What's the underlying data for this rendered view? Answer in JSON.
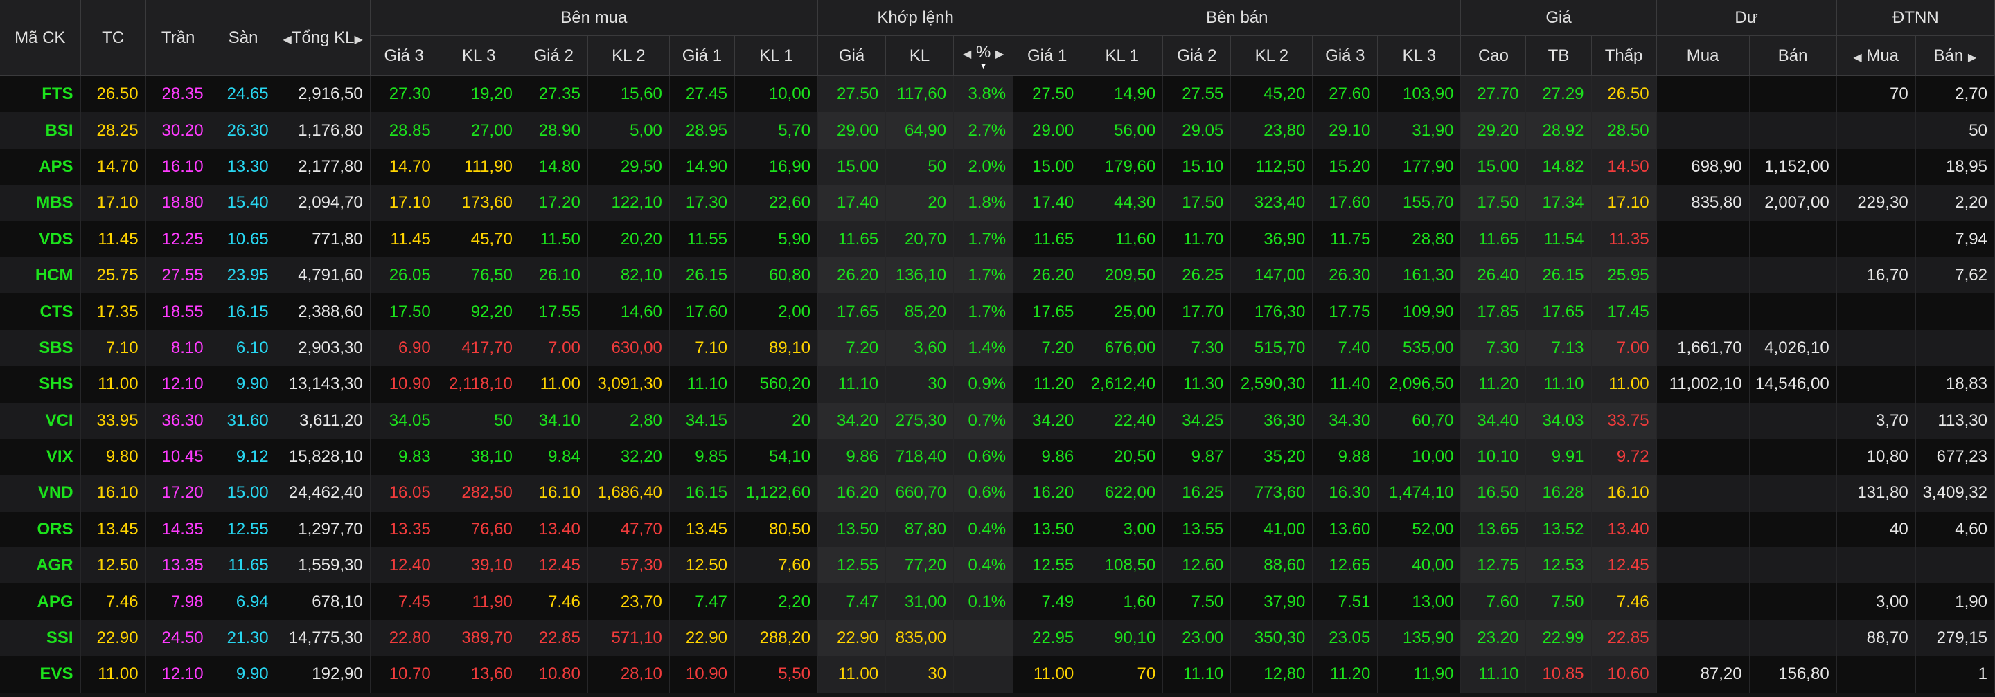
{
  "header": {
    "symbol": "Mã CK",
    "ref": "TC",
    "ceil": "Trần",
    "floor": "Sàn",
    "total_vol": "Tổng KL",
    "buy_side": "Bên mua",
    "matched": "Khớp lệnh",
    "sell_side": "Bên bán",
    "price": "Giá",
    "remain": "Dư",
    "foreign": "ĐTNN",
    "buy_cols": [
      "Giá 3",
      "KL 3",
      "Giá 2",
      "KL 2",
      "Giá 1",
      "KL 1"
    ],
    "match_cols": [
      "Giá",
      "KL",
      "%"
    ],
    "sell_cols": [
      "Giá 1",
      "KL 1",
      "Giá 2",
      "KL 2",
      "Giá 3",
      "KL 3"
    ],
    "price_cols": [
      "Cao",
      "TB",
      "Thấp"
    ],
    "remain_cols": [
      "Mua",
      "Bán"
    ],
    "foreign_cols": [
      "Mua",
      "Bán"
    ]
  },
  "colors": {
    "up": "#1ce31c",
    "down": "#f23c3c",
    "ref": "#ffd400",
    "ceil": "#ff3cff",
    "floor": "#28d6f0",
    "neutral": "#e8e8e8"
  },
  "rows": [
    {
      "sym": "FTS",
      "tc": "26.50",
      "tran": "28.35",
      "san": "24.65",
      "tkl": "2,916,50",
      "b3": "27.30",
      "bk3": "19,20",
      "b2": "27.35",
      "bk2": "15,60",
      "b1": "27.45",
      "bk1": "10,00",
      "mp": "27.50",
      "mk": "117,60",
      "pct": "3.8%",
      "s1": "27.50",
      "sk1": "14,90",
      "s2": "27.55",
      "sk2": "45,20",
      "s3": "27.60",
      "sk3": "103,90",
      "hi": "27.70",
      "avg": "27.29",
      "lo": "26.50",
      "rb": "",
      "rs": "",
      "fb": "70",
      "fs": "2,70"
    },
    {
      "sym": "BSI",
      "tc": "28.25",
      "tran": "30.20",
      "san": "26.30",
      "tkl": "1,176,80",
      "b3": "28.85",
      "bk3": "27,00",
      "b2": "28.90",
      "bk2": "5,00",
      "b1": "28.95",
      "bk1": "5,70",
      "mp": "29.00",
      "mk": "64,90",
      "pct": "2.7%",
      "s1": "29.00",
      "sk1": "56,00",
      "s2": "29.05",
      "sk2": "23,80",
      "s3": "29.10",
      "sk3": "31,90",
      "hi": "29.20",
      "avg": "28.92",
      "lo": "28.50",
      "rb": "",
      "rs": "",
      "fb": "",
      "fs": "50"
    },
    {
      "sym": "APS",
      "tc": "14.70",
      "tran": "16.10",
      "san": "13.30",
      "tkl": "2,177,80",
      "b3": "14.70",
      "bk3": "111,90",
      "b2": "14.80",
      "bk2": "29,50",
      "b1": "14.90",
      "bk1": "16,90",
      "mp": "15.00",
      "mk": "50",
      "pct": "2.0%",
      "s1": "15.00",
      "sk1": "179,60",
      "s2": "15.10",
      "sk2": "112,50",
      "s3": "15.20",
      "sk3": "177,90",
      "hi": "15.00",
      "avg": "14.82",
      "lo": "14.50",
      "rb": "698,90",
      "rs": "1,152,00",
      "fb": "",
      "fs": "18,95"
    },
    {
      "sym": "MBS",
      "tc": "17.10",
      "tran": "18.80",
      "san": "15.40",
      "tkl": "2,094,70",
      "b3": "17.10",
      "bk3": "173,60",
      "b2": "17.20",
      "bk2": "122,10",
      "b1": "17.30",
      "bk1": "22,60",
      "mp": "17.40",
      "mk": "20",
      "pct": "1.8%",
      "s1": "17.40",
      "sk1": "44,30",
      "s2": "17.50",
      "sk2": "323,40",
      "s3": "17.60",
      "sk3": "155,70",
      "hi": "17.50",
      "avg": "17.34",
      "lo": "17.10",
      "rb": "835,80",
      "rs": "2,007,00",
      "fb": "229,30",
      "fs": "2,20"
    },
    {
      "sym": "VDS",
      "tc": "11.45",
      "tran": "12.25",
      "san": "10.65",
      "tkl": "771,80",
      "b3": "11.45",
      "bk3": "45,70",
      "b2": "11.50",
      "bk2": "20,20",
      "b1": "11.55",
      "bk1": "5,90",
      "mp": "11.65",
      "mk": "20,70",
      "pct": "1.7%",
      "s1": "11.65",
      "sk1": "11,60",
      "s2": "11.70",
      "sk2": "36,90",
      "s3": "11.75",
      "sk3": "28,80",
      "hi": "11.65",
      "avg": "11.54",
      "lo": "11.35",
      "rb": "",
      "rs": "",
      "fb": "",
      "fs": "7,94"
    },
    {
      "sym": "HCM",
      "tc": "25.75",
      "tran": "27.55",
      "san": "23.95",
      "tkl": "4,791,60",
      "b3": "26.05",
      "bk3": "76,50",
      "b2": "26.10",
      "bk2": "82,10",
      "b1": "26.15",
      "bk1": "60,80",
      "mp": "26.20",
      "mk": "136,10",
      "pct": "1.7%",
      "s1": "26.20",
      "sk1": "209,50",
      "s2": "26.25",
      "sk2": "147,00",
      "s3": "26.30",
      "sk3": "161,30",
      "hi": "26.40",
      "avg": "26.15",
      "lo": "25.95",
      "rb": "",
      "rs": "",
      "fb": "16,70",
      "fs": "7,62"
    },
    {
      "sym": "CTS",
      "tc": "17.35",
      "tran": "18.55",
      "san": "16.15",
      "tkl": "2,388,60",
      "b3": "17.50",
      "bk3": "92,20",
      "b2": "17.55",
      "bk2": "14,60",
      "b1": "17.60",
      "bk1": "2,00",
      "mp": "17.65",
      "mk": "85,20",
      "pct": "1.7%",
      "s1": "17.65",
      "sk1": "25,00",
      "s2": "17.70",
      "sk2": "176,30",
      "s3": "17.75",
      "sk3": "109,90",
      "hi": "17.85",
      "avg": "17.65",
      "lo": "17.45",
      "rb": "",
      "rs": "",
      "fb": "",
      "fs": ""
    },
    {
      "sym": "SBS",
      "tc": "7.10",
      "tran": "8.10",
      "san": "6.10",
      "tkl": "2,903,30",
      "b3": "6.90",
      "bk3": "417,70",
      "b2": "7.00",
      "bk2": "630,00",
      "b1": "7.10",
      "bk1": "89,10",
      "mp": "7.20",
      "mk": "3,60",
      "pct": "1.4%",
      "s1": "7.20",
      "sk1": "676,00",
      "s2": "7.30",
      "sk2": "515,70",
      "s3": "7.40",
      "sk3": "535,00",
      "hi": "7.30",
      "avg": "7.13",
      "lo": "7.00",
      "rb": "1,661,70",
      "rs": "4,026,10",
      "fb": "",
      "fs": ""
    },
    {
      "sym": "SHS",
      "tc": "11.00",
      "tran": "12.10",
      "san": "9.90",
      "tkl": "13,143,30",
      "b3": "10.90",
      "bk3": "2,118,10",
      "b2": "11.00",
      "bk2": "3,091,30",
      "b1": "11.10",
      "bk1": "560,20",
      "mp": "11.10",
      "mk": "30",
      "pct": "0.9%",
      "s1": "11.20",
      "sk1": "2,612,40",
      "s2": "11.30",
      "sk2": "2,590,30",
      "s3": "11.40",
      "sk3": "2,096,50",
      "hi": "11.20",
      "avg": "11.10",
      "lo": "11.00",
      "rb": "11,002,10",
      "rs": "14,546,00",
      "fb": "",
      "fs": "18,83"
    },
    {
      "sym": "VCI",
      "tc": "33.95",
      "tran": "36.30",
      "san": "31.60",
      "tkl": "3,611,20",
      "b3": "34.05",
      "bk3": "50",
      "b2": "34.10",
      "bk2": "2,80",
      "b1": "34.15",
      "bk1": "20",
      "mp": "34.20",
      "mk": "275,30",
      "pct": "0.7%",
      "s1": "34.20",
      "sk1": "22,40",
      "s2": "34.25",
      "sk2": "36,30",
      "s3": "34.30",
      "sk3": "60,70",
      "hi": "34.40",
      "avg": "34.03",
      "lo": "33.75",
      "rb": "",
      "rs": "",
      "fb": "3,70",
      "fs": "113,30"
    },
    {
      "sym": "VIX",
      "tc": "9.80",
      "tran": "10.45",
      "san": "9.12",
      "tkl": "15,828,10",
      "b3": "9.83",
      "bk3": "38,10",
      "b2": "9.84",
      "bk2": "32,20",
      "b1": "9.85",
      "bk1": "54,10",
      "mp": "9.86",
      "mk": "718,40",
      "pct": "0.6%",
      "s1": "9.86",
      "sk1": "20,50",
      "s2": "9.87",
      "sk2": "35,20",
      "s3": "9.88",
      "sk3": "10,00",
      "hi": "10.10",
      "avg": "9.91",
      "lo": "9.72",
      "rb": "",
      "rs": "",
      "fb": "10,80",
      "fs": "677,23"
    },
    {
      "sym": "VND",
      "tc": "16.10",
      "tran": "17.20",
      "san": "15.00",
      "tkl": "24,462,40",
      "b3": "16.05",
      "bk3": "282,50",
      "b2": "16.10",
      "bk2": "1,686,40",
      "b1": "16.15",
      "bk1": "1,122,60",
      "mp": "16.20",
      "mk": "660,70",
      "pct": "0.6%",
      "s1": "16.20",
      "sk1": "622,00",
      "s2": "16.25",
      "sk2": "773,60",
      "s3": "16.30",
      "sk3": "1,474,10",
      "hi": "16.50",
      "avg": "16.28",
      "lo": "16.10",
      "rb": "",
      "rs": "",
      "fb": "131,80",
      "fs": "3,409,32"
    },
    {
      "sym": "ORS",
      "tc": "13.45",
      "tran": "14.35",
      "san": "12.55",
      "tkl": "1,297,70",
      "b3": "13.35",
      "bk3": "76,60",
      "b2": "13.40",
      "bk2": "47,70",
      "b1": "13.45",
      "bk1": "80,50",
      "mp": "13.50",
      "mk": "87,80",
      "pct": "0.4%",
      "s1": "13.50",
      "sk1": "3,00",
      "s2": "13.55",
      "sk2": "41,00",
      "s3": "13.60",
      "sk3": "52,00",
      "hi": "13.65",
      "avg": "13.52",
      "lo": "13.40",
      "rb": "",
      "rs": "",
      "fb": "40",
      "fs": "4,60"
    },
    {
      "sym": "AGR",
      "tc": "12.50",
      "tran": "13.35",
      "san": "11.65",
      "tkl": "1,559,30",
      "b3": "12.40",
      "bk3": "39,10",
      "b2": "12.45",
      "bk2": "57,30",
      "b1": "12.50",
      "bk1": "7,60",
      "mp": "12.55",
      "mk": "77,20",
      "pct": "0.4%",
      "s1": "12.55",
      "sk1": "108,50",
      "s2": "12.60",
      "sk2": "88,60",
      "s3": "12.65",
      "sk3": "40,00",
      "hi": "12.75",
      "avg": "12.53",
      "lo": "12.45",
      "rb": "",
      "rs": "",
      "fb": "",
      "fs": ""
    },
    {
      "sym": "APG",
      "tc": "7.46",
      "tran": "7.98",
      "san": "6.94",
      "tkl": "678,10",
      "b3": "7.45",
      "bk3": "11,90",
      "b2": "7.46",
      "bk2": "23,70",
      "b1": "7.47",
      "bk1": "2,20",
      "mp": "7.47",
      "mk": "31,00",
      "pct": "0.1%",
      "s1": "7.49",
      "sk1": "1,60",
      "s2": "7.50",
      "sk2": "37,90",
      "s3": "7.51",
      "sk3": "13,00",
      "hi": "7.60",
      "avg": "7.50",
      "lo": "7.46",
      "rb": "",
      "rs": "",
      "fb": "3,00",
      "fs": "1,90"
    },
    {
      "sym": "SSI",
      "tc": "22.90",
      "tran": "24.50",
      "san": "21.30",
      "tkl": "14,775,30",
      "b3": "22.80",
      "bk3": "389,70",
      "b2": "22.85",
      "bk2": "571,10",
      "b1": "22.90",
      "bk1": "288,20",
      "mp": "22.90",
      "mk": "835,00",
      "pct": "",
      "s1": "22.95",
      "sk1": "90,10",
      "s2": "23.00",
      "sk2": "350,30",
      "s3": "23.05",
      "sk3": "135,90",
      "hi": "23.20",
      "avg": "22.99",
      "lo": "22.85",
      "rb": "",
      "rs": "",
      "fb": "88,70",
      "fs": "279,15"
    },
    {
      "sym": "EVS",
      "tc": "11.00",
      "tran": "12.10",
      "san": "9.90",
      "tkl": "192,90",
      "b3": "10.70",
      "bk3": "13,60",
      "b2": "10.80",
      "bk2": "28,10",
      "b1": "10.90",
      "bk1": "5,50",
      "mp": "11.00",
      "mk": "30",
      "pct": "",
      "s1": "11.00",
      "sk1": "70",
      "s2": "11.10",
      "sk2": "12,80",
      "s3": "11.20",
      "sk3": "11,90",
      "hi": "11.10",
      "avg": "10.85",
      "lo": "10.60",
      "rb": "87,20",
      "rs": "156,80",
      "fb": "",
      "fs": "1"
    }
  ]
}
